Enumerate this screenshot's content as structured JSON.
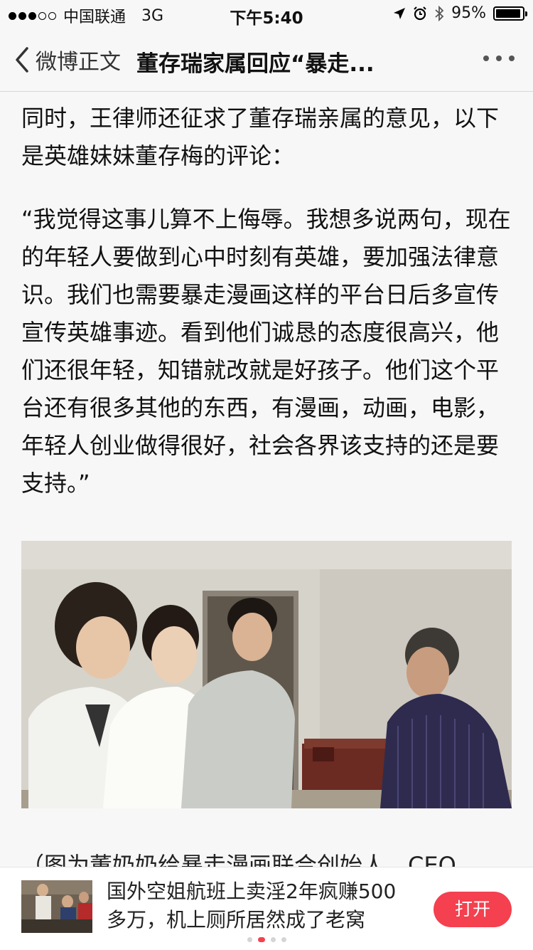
{
  "status_bar": {
    "carrier": "中国联通",
    "network": "3G",
    "time": "下午5:40",
    "battery": "95%",
    "signal_filled": 3,
    "signal_total": 5
  },
  "nav": {
    "back_label": "微博正文",
    "title": "董存瑞家属回应“暴走..."
  },
  "article": {
    "paragraphs": [
      "同时，王律师还征求了董存瑞亲属的意见，以下是英雄妹妹董存梅的评论：",
      "“我觉得这事儿算不上侮辱。我想多说两句，现在的年轻人要做到心中时刻有英雄，要加强法律意识。我们也需要暴走漫画这样的平台日后多宣传宣传英雄事迹。看到他们诚恳的态度很高兴，他们还很年轻，知错就改就是好孩子。他们这个平台还有很多其他的东西，有漫画，动画，电影，年轻人创业做得很好，社会各界该支持的还是要支持。”"
    ],
    "cutoff_text": "（图为董奶奶给暴走漫画联合创始人、CEO"
  },
  "banner": {
    "text": "国外空姐航班上卖淫2年疯赚500多万，机上厕所居然成了老窝",
    "button_label": "打开",
    "pages": 4,
    "active_page": 2
  },
  "colors": {
    "accent": "#f4404f",
    "background": "#f7f7f7"
  }
}
